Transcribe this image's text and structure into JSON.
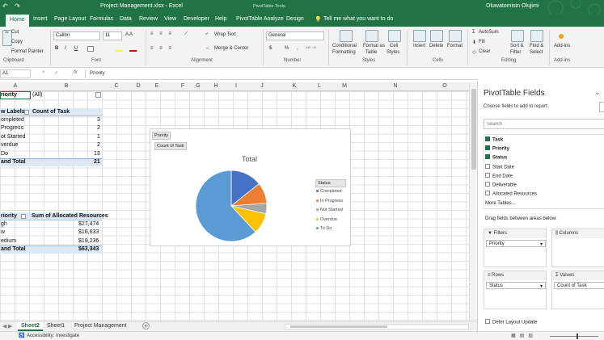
{
  "title_bar": {
    "file_name": "Project Management.xlsx",
    "separator": "-",
    "app": "Excel",
    "context_tools": "PivotTable Tools",
    "user": "Oluwatomisin Olujimi"
  },
  "tabs": [
    "Home",
    "Insert",
    "Page Layout",
    "Formulas",
    "Data",
    "Review",
    "View",
    "Developer",
    "Help",
    "PivotTable Analyze",
    "Design"
  ],
  "tell_me": "Tell me what you want to do",
  "ribbon": {
    "clipboard": {
      "cut": "Cut",
      "copy": "Copy",
      "format_painter": "Format Painter",
      "group": "Clipboard"
    },
    "font": {
      "font_name": "Calibri",
      "font_size": "11",
      "group": "Font"
    },
    "alignment": {
      "wrap_text": "Wrap Text",
      "merge_center": "Merge & Center",
      "group": "Alignment"
    },
    "number": {
      "format": "General",
      "currency": "$",
      "percent": "%",
      "comma": ",",
      "group": "Number"
    },
    "styles": {
      "conditional_l1": "Conditional",
      "conditional_l2": "Formatting",
      "format_as_l1": "Format as",
      "format_as_l2": "Table",
      "cell_l1": "Cell",
      "cell_l2": "Styles",
      "group": "Styles"
    },
    "cells": {
      "insert": "Insert",
      "delete": "Delete",
      "format": "Format",
      "group": "Cells"
    },
    "editing": {
      "autosum": "AutoSum",
      "fill": "Fill",
      "clear": "Clear",
      "sort_l1": "Sort &",
      "sort_l2": "Filter",
      "find_l1": "Find &",
      "find_l2": "Select",
      "group": "Editing"
    },
    "addins": {
      "label": "Add-ins",
      "group": "Add-ins"
    }
  },
  "formula_bar": {
    "name_box": "A1",
    "cancel": "×",
    "enter": "✓",
    "fx": "fx",
    "content": "Priority"
  },
  "columns": [
    "A",
    "B",
    "C",
    "D",
    "E",
    "F",
    "G",
    "H",
    "I",
    "J",
    "K",
    "L",
    "M",
    "N",
    "O"
  ],
  "pivot1": {
    "filter_label": "riority",
    "filter_value": "(All)",
    "header_row": "w Labels",
    "header_value": "Count of Task",
    "rows": [
      {
        "label": "ompleted",
        "value": "3"
      },
      {
        "label": "Progress",
        "value": "2"
      },
      {
        "label": "ot Started",
        "value": "1"
      },
      {
        "label": "verdue",
        "value": "2"
      },
      {
        "label": "Do",
        "value": "13"
      }
    ],
    "total_label": "and Total",
    "total_value": "21"
  },
  "pivot2": {
    "header_row": "riority",
    "header_value": "Sum of Allocated Resources",
    "rows": [
      {
        "label": "gh",
        "value": "$27,474"
      },
      {
        "label": "w",
        "value": "$16,633"
      },
      {
        "label": "edium",
        "value": "$19,236"
      }
    ],
    "total_label": "and Total",
    "total_value": "$63,343"
  },
  "chart_data": {
    "type": "pie",
    "filter_button": "Priority",
    "value_button": "Count of Task",
    "title": "Total",
    "legend_button": "Status",
    "categories": [
      "Completed",
      "In Progress",
      "Not Started",
      "Overdue",
      "To Do"
    ],
    "values": [
      3,
      2,
      1,
      2,
      13
    ],
    "colors": [
      "#4472C4",
      "#ED7D31",
      "#A5A5A5",
      "#FFC000",
      "#5B9BD5"
    ],
    "legend_position": "right"
  },
  "sheet_tabs": [
    "Sheet2",
    "Sheet1",
    "Project Management"
  ],
  "status_bar": {
    "accessibility": "Accessibility: Investigate"
  },
  "pivot_pane": {
    "title": "PivotTable Fields",
    "subtitle": "Choose fields to add to report:",
    "search_placeholder": "Search",
    "fields": [
      {
        "name": "Task",
        "checked": true
      },
      {
        "name": "Priority",
        "checked": true
      },
      {
        "name": "Status",
        "checked": true
      },
      {
        "name": "Start Date",
        "checked": false
      },
      {
        "name": "End Date",
        "checked": false
      },
      {
        "name": "Deliverable",
        "checked": false
      },
      {
        "name": "Allocated Resources",
        "checked": false
      }
    ],
    "more_tables": "More Tables...",
    "drag_hint": "Drag fields between areas below:",
    "areas": {
      "filters": {
        "label": "Filters",
        "item": "Priority"
      },
      "columns": {
        "label": "Columns"
      },
      "rows": {
        "label": "Rows",
        "item": "Status"
      },
      "values": {
        "label": "Values",
        "item": "Count of Task"
      }
    },
    "defer_update": "Defer Layout Update"
  }
}
